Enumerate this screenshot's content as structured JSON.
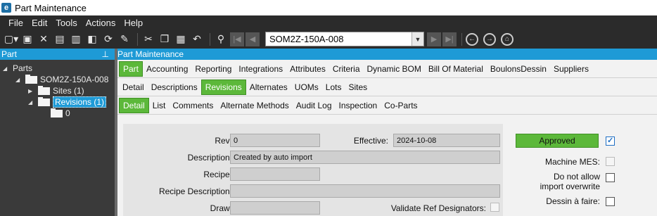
{
  "window": {
    "title": "Part Maintenance",
    "logo_letter": "e"
  },
  "menu": [
    "File",
    "Edit",
    "Tools",
    "Actions",
    "Help"
  ],
  "toolbar": {
    "part_combo_value": "SOM2Z-150A-008"
  },
  "left_panel": {
    "header": "Part",
    "pin_icon": "pin-icon",
    "tree": {
      "root": "Parts",
      "part": "SOM2Z-150A-008",
      "sites": "Sites (1)",
      "revisions": "Revisions (1)",
      "revision_child": "0"
    }
  },
  "right_panel": {
    "header": "Part Maintenance",
    "tabs_level1": [
      "Part",
      "Accounting",
      "Reporting",
      "Integrations",
      "Attributes",
      "Criteria",
      "Dynamic BOM",
      "Bill Of Material",
      "BoulonsDessin",
      "Suppliers"
    ],
    "tabs_level2": [
      "Detail",
      "Descriptions",
      "Revisions",
      "Alternates",
      "UOMs",
      "Lots",
      "Sites"
    ],
    "tabs_level3": [
      "Detail",
      "List",
      "Comments",
      "Alternate Methods",
      "Audit Log",
      "Inspection",
      "Co-Parts"
    ]
  },
  "form": {
    "rev_label": "Rev:",
    "rev_value": "0",
    "effective_label": "Effective:",
    "effective_value": "2024-10-08",
    "description_label": "Description:",
    "description_value": "Created by auto import",
    "recipe_label": "Recipe:",
    "recipe_value": "",
    "recipe_description_label": "Recipe Description:",
    "recipe_description_value": "",
    "draw_label": "Draw:",
    "draw_value": "",
    "validate_label": "Validate Ref Designators:"
  },
  "right_form": {
    "status": "Approved",
    "machine_mes_label": "Machine MES:",
    "do_not_allow_label_1": "Do not allow",
    "do_not_allow_label_2": "import overwrite",
    "dessin_label": "Dessin à faire:"
  },
  "colors": {
    "accent": "#1e9ad6",
    "active_tab": "#5cb83a",
    "dark_bar": "#2b2b2b"
  }
}
